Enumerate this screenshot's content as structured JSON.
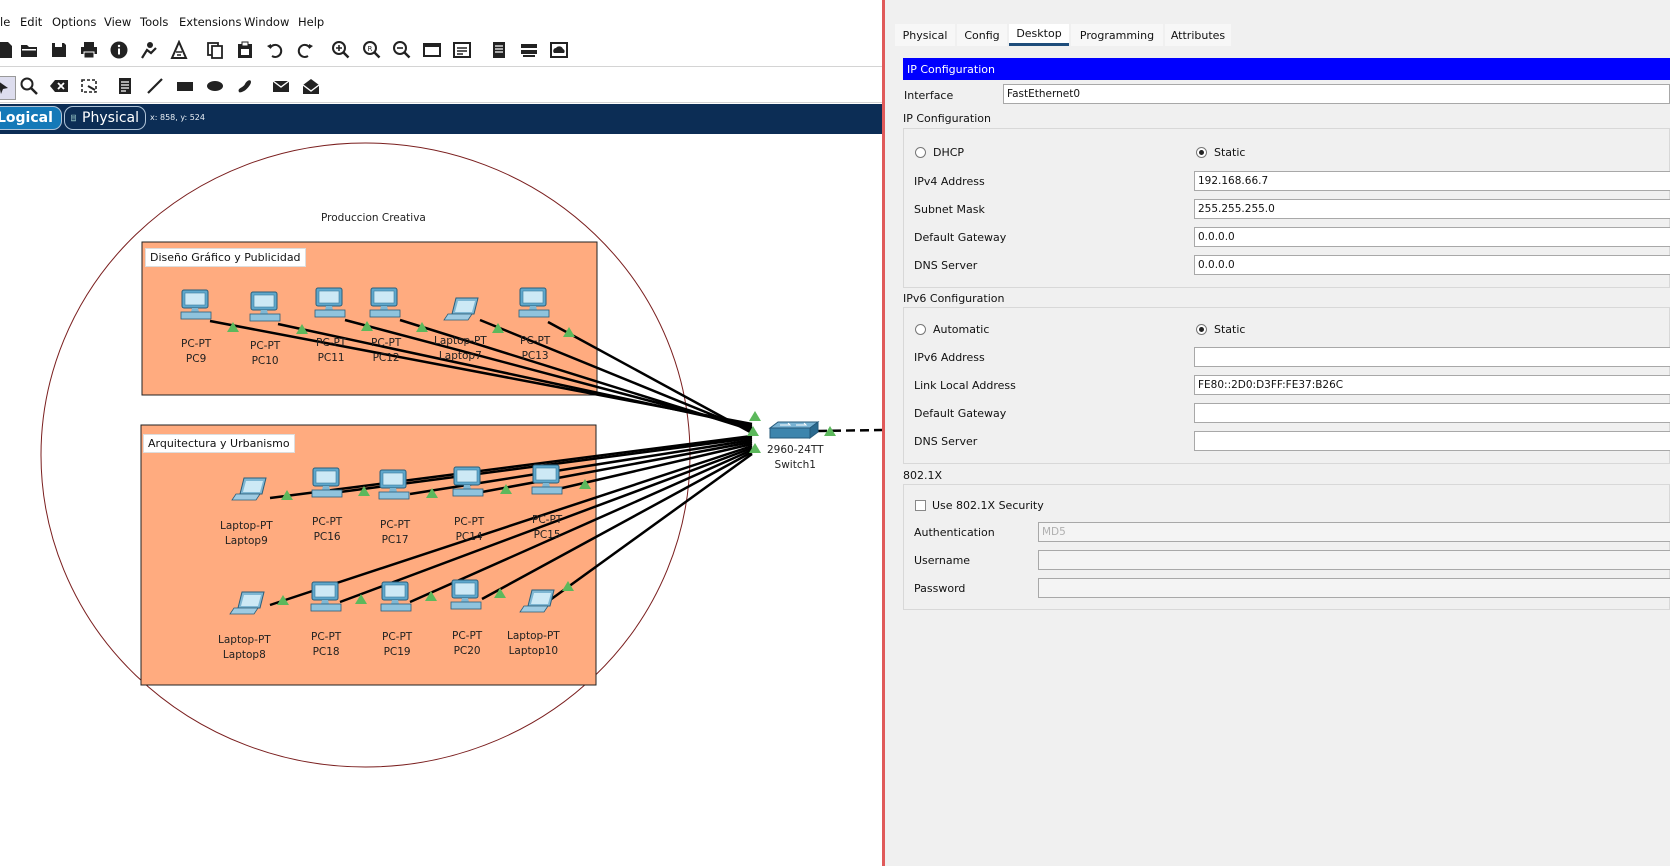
{
  "menu": [
    "File",
    "Edit",
    "Options",
    "View",
    "Tools",
    "Extensions",
    "Window",
    "Help"
  ],
  "menu_visible": [
    "le",
    "Edit",
    "Options",
    "View",
    "Tools",
    "Extensions",
    "Window",
    "Help"
  ],
  "toolbar1_icons": [
    "new-file-icon",
    "open-folder-icon",
    "save-icon",
    "print-icon",
    "info-icon",
    "network-wizard-icon",
    "activity-wizard-icon",
    "copy-icon",
    "paste-icon",
    "undo-icon",
    "redo-icon",
    "zoom-in-icon",
    "zoom-reset-icon",
    "zoom-out-icon",
    "drawing-palette-icon",
    "custom-device-dialog-icon",
    "doc-icon",
    "cluster-icon",
    "cloud-viewer-icon"
  ],
  "toolbar2_icons": [
    "select-icon",
    "inspect-icon",
    "delete-icon",
    "resize-shape-icon",
    "note-icon",
    "line-icon",
    "rectangle-icon",
    "ellipse-icon",
    "freeform-icon",
    "add-simple-pdu-icon",
    "add-complex-pdu-icon"
  ],
  "view_tabs": {
    "logical": "Logical",
    "physical": "Physical"
  },
  "coords": "x: 858, y: 524",
  "canvas": {
    "cluster_label": "Produccion Creativa",
    "area1_title": "Diseño Gráfico y Publicidad",
    "area2_title": "Arquitectura y Urbanismo",
    "area_color": "#ffab7f",
    "switch": {
      "model": "2960-24TT",
      "name": "Switch1"
    },
    "devices_area1": [
      {
        "type": "PC-PT",
        "name": "PC9"
      },
      {
        "type": "PC-PT",
        "name": "PC10"
      },
      {
        "type": "PC-PT",
        "name": "PC11"
      },
      {
        "type": "PC-PT",
        "name": "PC12"
      },
      {
        "type": "Laptop-PT",
        "name": "Laptop7"
      },
      {
        "type": "PC-PT",
        "name": "PC13"
      }
    ],
    "devices_area2_row1": [
      {
        "type": "Laptop-PT",
        "name": "Laptop9"
      },
      {
        "type": "PC-PT",
        "name": "PC16"
      },
      {
        "type": "PC-PT",
        "name": "PC17"
      },
      {
        "type": "PC-PT",
        "name": "PC14"
      },
      {
        "type": "PC-PT",
        "name": "PC15"
      }
    ],
    "devices_area2_row2": [
      {
        "type": "Laptop-PT",
        "name": "Laptop8"
      },
      {
        "type": "PC-PT",
        "name": "PC18"
      },
      {
        "type": "PC-PT",
        "name": "PC19"
      },
      {
        "type": "PC-PT",
        "name": "PC20"
      },
      {
        "type": "Laptop-PT",
        "name": "Laptop10"
      }
    ],
    "link_up_color": "#5cb85c"
  },
  "config": {
    "tabs": [
      "Physical",
      "Config",
      "Desktop",
      "Programming",
      "Attributes"
    ],
    "active_tab": "Desktop",
    "header": "IP Configuration",
    "header_color": "#0000ff",
    "interface_label": "Interface",
    "interface_value": "FastEthernet0",
    "ip_section": "IP Configuration",
    "dhcp_label": "DHCP",
    "static_label": "Static",
    "ipv4_label": "IPv4 Address",
    "ipv4_value": "192.168.66.7",
    "mask_label": "Subnet Mask",
    "mask_value": "255.255.255.0",
    "gw_label": "Default Gateway",
    "gw_value": "0.0.0.0",
    "dns_label": "DNS Server",
    "dns_value": "0.0.0.0",
    "ipv6_section": "IPv6 Configuration",
    "auto_label": "Automatic",
    "static6_label": "Static",
    "ipv6_label": "IPv6 Address",
    "ipv6_value": "",
    "lla_label": "Link Local Address",
    "lla_value": "FE80::2D0:D3FF:FE37:B26C",
    "gw6_label": "Default Gateway",
    "gw6_value": "",
    "dns6_label": "DNS Server",
    "dns6_value": "",
    "dot1x_section": "802.1X",
    "dot1x_check_label": "Use 802.1X Security",
    "auth_label": "Authentication",
    "auth_value": "MD5",
    "user_label": "Username",
    "user_value": "",
    "pass_label": "Password",
    "pass_value": ""
  }
}
